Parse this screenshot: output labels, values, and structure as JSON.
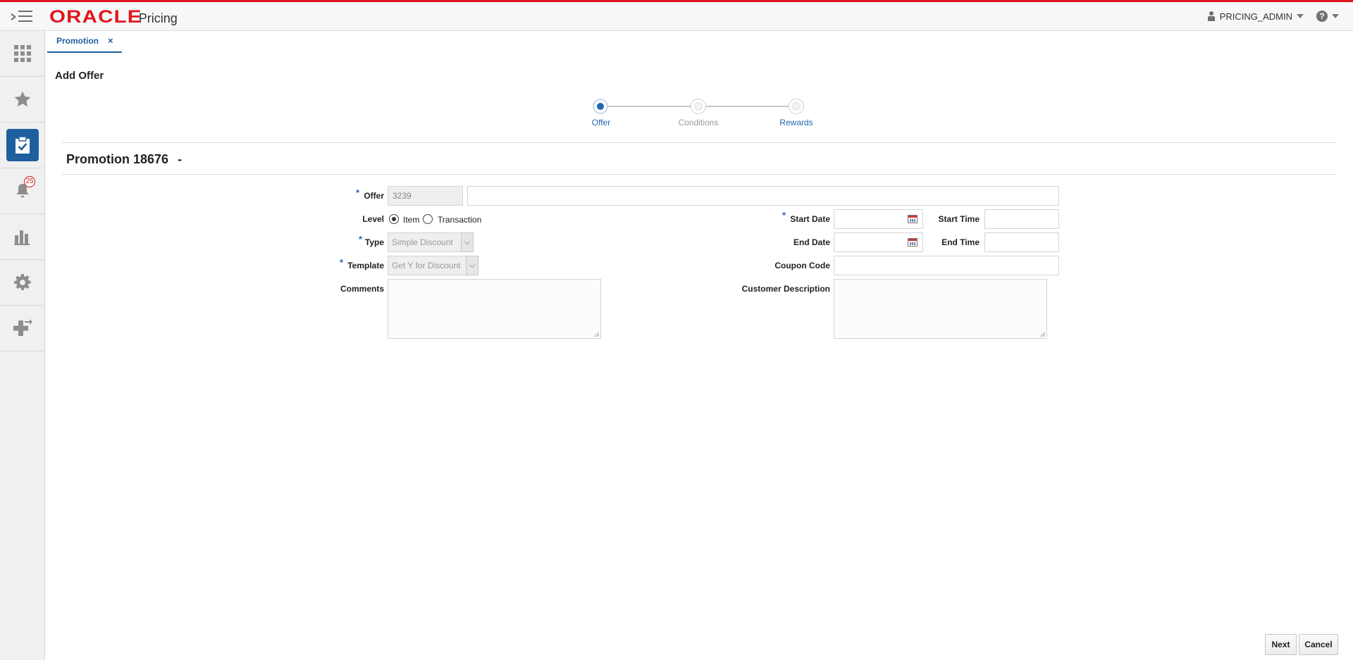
{
  "header": {
    "brand": "ORACLE",
    "brand_mark": "®",
    "app_name": "Pricing",
    "user": "PRICING_ADMIN",
    "help_glyph": "?"
  },
  "sidebar": {
    "items": [
      {
        "name": "tasks-grid",
        "icon": "grid-icon"
      },
      {
        "name": "favorites",
        "icon": "star-icon"
      },
      {
        "name": "tasks",
        "icon": "clipboard-check-icon",
        "active": true
      },
      {
        "name": "notifications",
        "icon": "bell-icon",
        "badge": "25"
      },
      {
        "name": "reports",
        "icon": "bar-chart-icon"
      },
      {
        "name": "settings",
        "icon": "gear-icon"
      },
      {
        "name": "add",
        "icon": "plus-arrow-icon"
      }
    ],
    "accent": "#1e5f9e"
  },
  "tabs": [
    {
      "label": "Promotion",
      "close": "×"
    }
  ],
  "page": {
    "title": "Add Offer",
    "section_title": "Promotion 18676",
    "section_suffix": "-"
  },
  "train": {
    "steps": [
      {
        "label": "Offer",
        "state": "active"
      },
      {
        "label": "Conditions",
        "state": "disabled"
      },
      {
        "label": "Rewards",
        "state": "link"
      }
    ]
  },
  "form": {
    "required_mark": "*",
    "offer": {
      "label": "Offer",
      "id_value": "3239",
      "name_value": ""
    },
    "level": {
      "label": "Level",
      "options": [
        "Item",
        "Transaction"
      ],
      "selected": "Item"
    },
    "type": {
      "label": "Type",
      "value": "Simple Discount"
    },
    "template": {
      "label": "Template",
      "value": "Get Y for Discount"
    },
    "comments": {
      "label": "Comments",
      "value": ""
    },
    "start_date": {
      "label": "Start Date",
      "value": ""
    },
    "start_time": {
      "label": "Start Time",
      "value": ""
    },
    "end_date": {
      "label": "End Date",
      "value": ""
    },
    "end_time": {
      "label": "End Time",
      "value": ""
    },
    "coupon_code": {
      "label": "Coupon Code",
      "value": ""
    },
    "customer_description": {
      "label": "Customer Description",
      "value": ""
    }
  },
  "actions": {
    "next": "Next",
    "cancel": "Cancel"
  },
  "colors": {
    "brand_red": "#e2151d",
    "link_blue": "#1e67b3"
  }
}
